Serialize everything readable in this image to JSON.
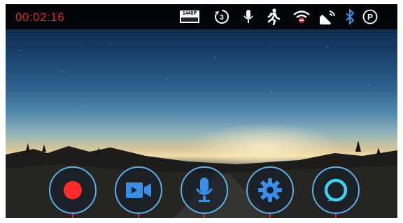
{
  "status_bar": {
    "timer": "00:02:16",
    "resolution_badge": "1440P",
    "icons": [
      "resolution-icon",
      "loop-3min-icon",
      "microphone-status-icon",
      "motion-detection-icon",
      "wifi-status-icon",
      "gps-icon",
      "bluetooth-icon",
      "parking-mode-icon"
    ],
    "parking_label": "P",
    "loop_label": "3"
  },
  "controls": [
    {
      "name": "record-button",
      "icon": "record-icon",
      "color": "#ff2a2a"
    },
    {
      "name": "video-mode-button",
      "icon": "video-camera-icon",
      "color": "#3a8ee6"
    },
    {
      "name": "microphone-button",
      "icon": "microphone-icon",
      "color": "#3a8ee6"
    },
    {
      "name": "settings-button",
      "icon": "gear-icon",
      "color": "#3a8ee6"
    },
    {
      "name": "alexa-button",
      "icon": "alexa-icon",
      "color": "#3fd0f0"
    }
  ],
  "colors": {
    "timer": "#e0282e",
    "accent": "#3a8ee6",
    "ring": "#5fb0e6",
    "pointer": "#e0282e"
  }
}
